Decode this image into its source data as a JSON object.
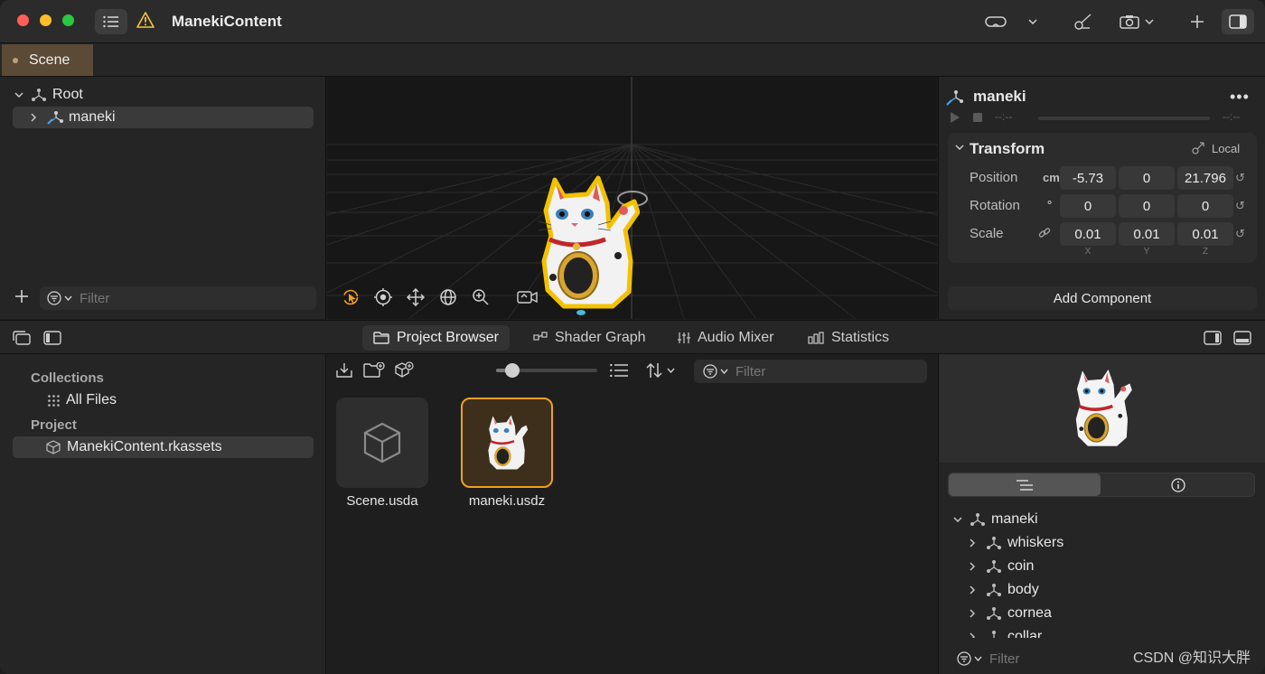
{
  "window": {
    "title": "ManekiContent"
  },
  "tabs": {
    "scene": "Scene"
  },
  "hierarchy": {
    "root_label": "Root",
    "child_label": "maneki",
    "filter_placeholder": "Filter"
  },
  "inspector": {
    "entity_name": "maneki",
    "time_start": "--:--",
    "time_end": "--:--",
    "section_title": "Transform",
    "space_label": "Local",
    "position": {
      "label": "Position",
      "unit": "cm",
      "x": "-5.73",
      "y": "0",
      "z": "21.796"
    },
    "rotation": {
      "label": "Rotation",
      "unit": "°",
      "x": "0",
      "y": "0",
      "z": "0"
    },
    "scale": {
      "label": "Scale",
      "x": "0.01",
      "y": "0.01",
      "z": "0.01"
    },
    "axis_labels": {
      "x": "X",
      "y": "Y",
      "z": "Z"
    },
    "add_component": "Add Component"
  },
  "bottom_tabs": {
    "project_browser": "Project Browser",
    "shader_graph": "Shader Graph",
    "audio_mixer": "Audio Mixer",
    "statistics": "Statistics"
  },
  "collections": {
    "collections_header": "Collections",
    "all_files": "All Files",
    "project_header": "Project",
    "project_item": "ManekiContent.rkassets"
  },
  "browser": {
    "filter_placeholder": "Filter",
    "zoom_value": 0.1,
    "assets": [
      {
        "name": "Scene.usda"
      },
      {
        "name": "maneki.usdz"
      }
    ]
  },
  "content_tree": {
    "root": "maneki",
    "children": [
      "whiskers",
      "coin",
      "body",
      "cornea",
      "collar"
    ],
    "filter_placeholder": "Filter"
  },
  "watermark": "CSDN @知识大胖",
  "colors": {
    "accent_selection": "#f0a020",
    "scene_tab": "#5b4a35",
    "entity_icon": "#4aa3e0"
  }
}
